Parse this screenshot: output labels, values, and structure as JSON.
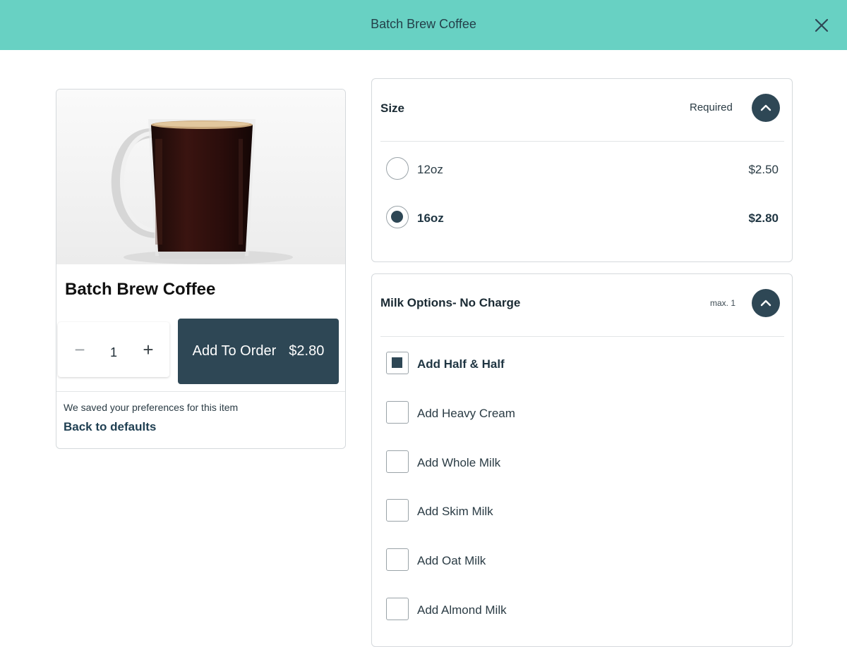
{
  "header": {
    "title": "Batch Brew Coffee",
    "close_icon": "close-icon",
    "background_color": "#68d1c3"
  },
  "product": {
    "image_icon": "coffee-mug-image",
    "title": "Batch Brew Coffee",
    "quantity": "1",
    "minus_icon": "minus-icon",
    "plus_icon": "plus-icon",
    "add_button": {
      "label": "Add To Order",
      "price": "$2.80",
      "color": "#2e4755"
    },
    "saved_note": "We saved your preferences for this item",
    "back_link": "Back to defaults"
  },
  "size_group": {
    "title": "Size",
    "status": "Required",
    "toggle_icon": "chevron-up-icon",
    "options": [
      {
        "label": "12oz",
        "price": "$2.50",
        "selected": false
      },
      {
        "label": "16oz",
        "price": "$2.80",
        "selected": true
      }
    ]
  },
  "milk_group": {
    "title": "Milk Options- No Charge",
    "limit": "max. 1",
    "toggle_icon": "chevron-up-icon",
    "options": [
      {
        "label": "Add Half & Half",
        "selected": true
      },
      {
        "label": "Add Heavy Cream",
        "selected": false
      },
      {
        "label": "Add Whole Milk",
        "selected": false
      },
      {
        "label": "Add Skim Milk",
        "selected": false
      },
      {
        "label": "Add Oat Milk",
        "selected": false
      },
      {
        "label": "Add Almond Milk",
        "selected": false
      }
    ]
  }
}
